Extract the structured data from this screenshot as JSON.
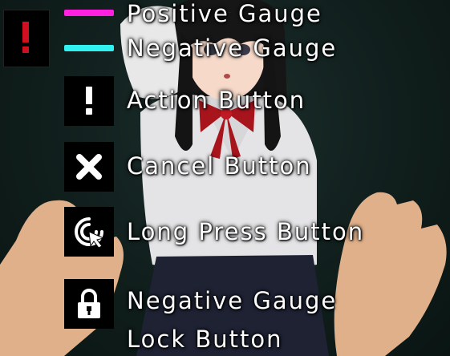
{
  "legend": {
    "positive_gauge": {
      "label": "Positive Gauge",
      "color": "#ff20e0"
    },
    "negative_gauge": {
      "label": "Negative Gauge",
      "color": "#30f0f0"
    },
    "action_button": {
      "label": "Action Button",
      "icon": "exclamation-icon"
    },
    "cancel_button": {
      "label": "Cancel Button",
      "icon": "x-icon"
    },
    "long_press_button": {
      "label": "Long Press Button",
      "icon": "cursor-press-icon"
    },
    "lock_button": {
      "label_line1": "Negative Gauge",
      "label_line2": "Lock Button",
      "icon": "lock-icon"
    }
  },
  "colors": {
    "background": "#0f1d1b",
    "icon_bg": "#000000",
    "text": "#ffffff",
    "accent_red": "#d01020"
  }
}
